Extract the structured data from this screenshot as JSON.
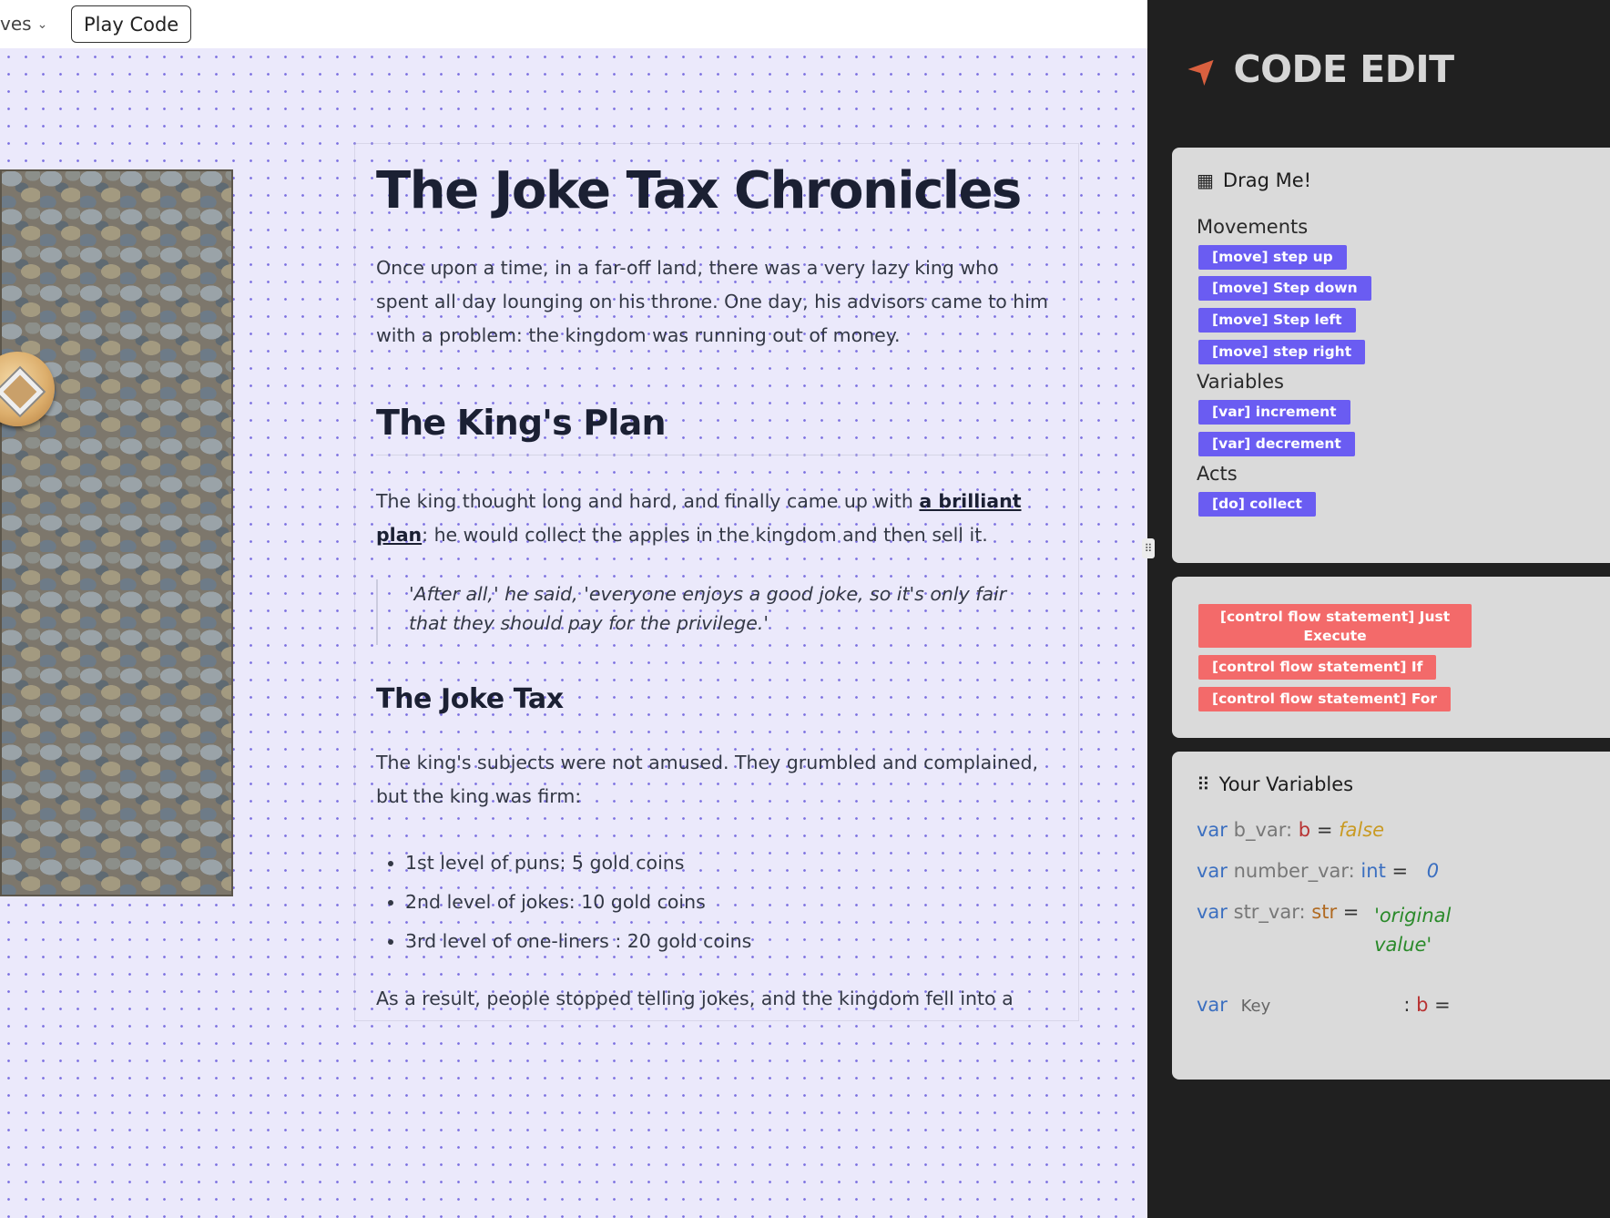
{
  "topbar": {
    "moves_label": "ves",
    "play_button": "Play Code"
  },
  "article": {
    "title": "The Joke Tax Chronicles",
    "intro": "Once upon a time, in a far-off land, there was a very lazy king who spent all day lounging on his throne. One day, his advisors came to him with a problem: the kingdom was running out of money.",
    "section1_heading": "The King's Plan",
    "plan_before": "The king thought long and hard, and finally came up with ",
    "plan_link": "a brilliant plan",
    "plan_after": ": he would collect the apples in the kingdom and then sell it.",
    "quote": "'After all,' he said, 'everyone enjoys a good joke, so it's only fair that they should pay for the privilege.'",
    "section2_heading": "The Joke Tax",
    "subjects": "The king's subjects were not amused. They grumbled and complained, but the king was firm:",
    "tax_levels": [
      "1st level of puns: 5 gold coins",
      "2nd level of jokes: 10 gold coins",
      "3rd level of one-liners : 20 gold coins"
    ],
    "result": "As a result, people stopped telling jokes, and the kingdom fell into a"
  },
  "editor": {
    "title": "CODE EDIT",
    "rocket_icon": "rocket-icon",
    "drag_header": "Drag Me!",
    "movements_label": "Movements",
    "movements": [
      "[move] step up",
      "[move] Step down",
      "[move] Step left",
      "[move] step right"
    ],
    "variables_label": "Variables",
    "variables": [
      "[var] increment",
      "[var] decrement"
    ],
    "acts_label": "Acts",
    "acts": [
      "[do] collect"
    ],
    "control_flow": [
      "[control flow statement] Just Execute",
      "[control flow statement] If",
      "[control flow statement] For"
    ],
    "your_variables_header": "Your Variables",
    "var_keyword": "var",
    "vars": [
      {
        "name": "b_var:",
        "type": "b",
        "value": "false"
      },
      {
        "name": "number_var:",
        "type": "int",
        "value": "0"
      },
      {
        "name": "str_var:",
        "type": "str",
        "value": "'original value'"
      }
    ],
    "key_placeholder": "Key",
    "new_var_type": "b"
  },
  "colors": {
    "chip_purple": "#6a5cf2",
    "chip_red": "#f36a6a",
    "panel_dark": "#202020",
    "card_gray": "#dadada",
    "canvas_bg": "#ebe9fb"
  }
}
